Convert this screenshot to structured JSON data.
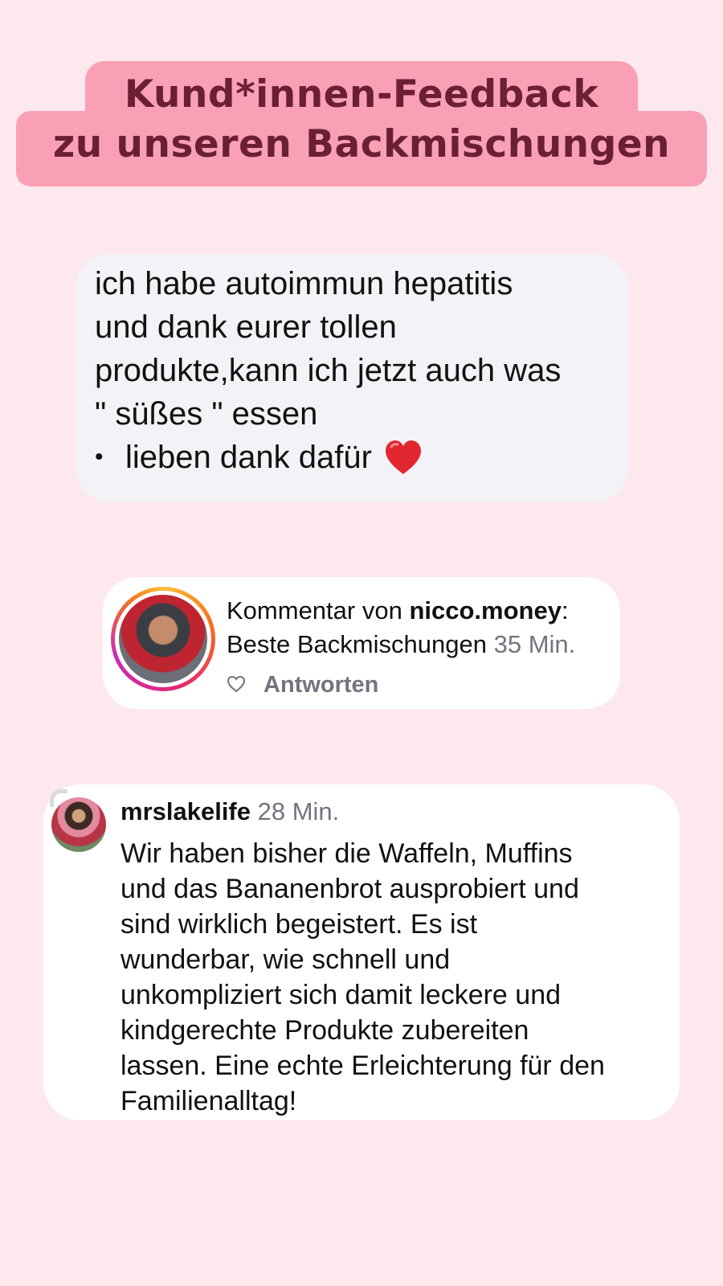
{
  "header": {
    "title_line1": "Kund*innen-Feedback",
    "title_line2": "zu unseren Backmischungen"
  },
  "message": {
    "lines": [
      "ich habe autoimmun hepatitis",
      "und dank eurer tollen",
      "produkte,kann ich jetzt auch was",
      "\" süßes \" essen"
    ],
    "bullet": "•",
    "bullet_text": "lieben dank dafür",
    "bullet_icon": "red-heart-icon"
  },
  "comment": {
    "prefix": "Kommentar von ",
    "username": "nicco.money",
    "suffix": ":",
    "text": "Beste Backmischungen",
    "time": "35 Min.",
    "like_icon": "heart-outline-icon",
    "reply_label": "Antworten"
  },
  "review": {
    "username": "mrslakelife",
    "time": "28 Min.",
    "lines": [
      "Wir haben bisher die Waffeln, Muffins",
      "und das Bananenbrot ausprobiert und",
      "sind wirklich begeistert. Es ist",
      "wunderbar, wie schnell und",
      "unkompliziert sich damit leckere und",
      "kindgerechte Produkte zubereiten",
      "lassen. Eine echte Erleichterung für den",
      "Familienalltag!"
    ]
  },
  "colors": {
    "page_background": "#fde9ed",
    "title_highlight": "#f9a0b7",
    "title_text": "#6b1f35",
    "bubble": "#f2f2f7",
    "muted_text": "#737380"
  }
}
